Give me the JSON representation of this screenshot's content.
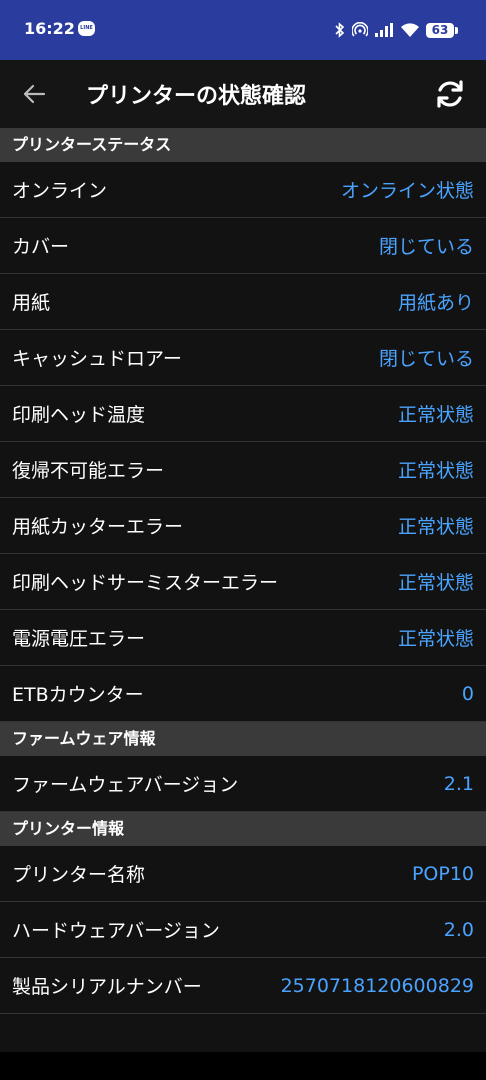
{
  "status_bar": {
    "time": "16:22",
    "line_badge": "LINE",
    "battery": "63"
  },
  "header": {
    "title": "プリンターの状態確認"
  },
  "sections": {
    "printer_status": {
      "title": "プリンターステータス",
      "rows": [
        {
          "label": "オンライン",
          "value": "オンライン状態"
        },
        {
          "label": "カバー",
          "value": "閉じている"
        },
        {
          "label": "用紙",
          "value": "用紙あり"
        },
        {
          "label": "キャッシュドロアー",
          "value": "閉じている"
        },
        {
          "label": "印刷ヘッド温度",
          "value": "正常状態"
        },
        {
          "label": "復帰不可能エラー",
          "value": "正常状態"
        },
        {
          "label": "用紙カッターエラー",
          "value": "正常状態"
        },
        {
          "label": "印刷ヘッドサーミスターエラー",
          "value": "正常状態"
        },
        {
          "label": "電源電圧エラー",
          "value": "正常状態"
        },
        {
          "label": "ETBカウンター",
          "value": "0"
        }
      ]
    },
    "firmware": {
      "title": "ファームウェア情報",
      "rows": [
        {
          "label": "ファームウェアバージョン",
          "value": "2.1"
        }
      ]
    },
    "printer_info": {
      "title": "プリンター情報",
      "rows": [
        {
          "label": "プリンター名称",
          "value": "POP10"
        },
        {
          "label": "ハードウェアバージョン",
          "value": "2.0"
        },
        {
          "label": "製品シリアルナンバー",
          "value": "2570718120600829"
        }
      ]
    }
  }
}
